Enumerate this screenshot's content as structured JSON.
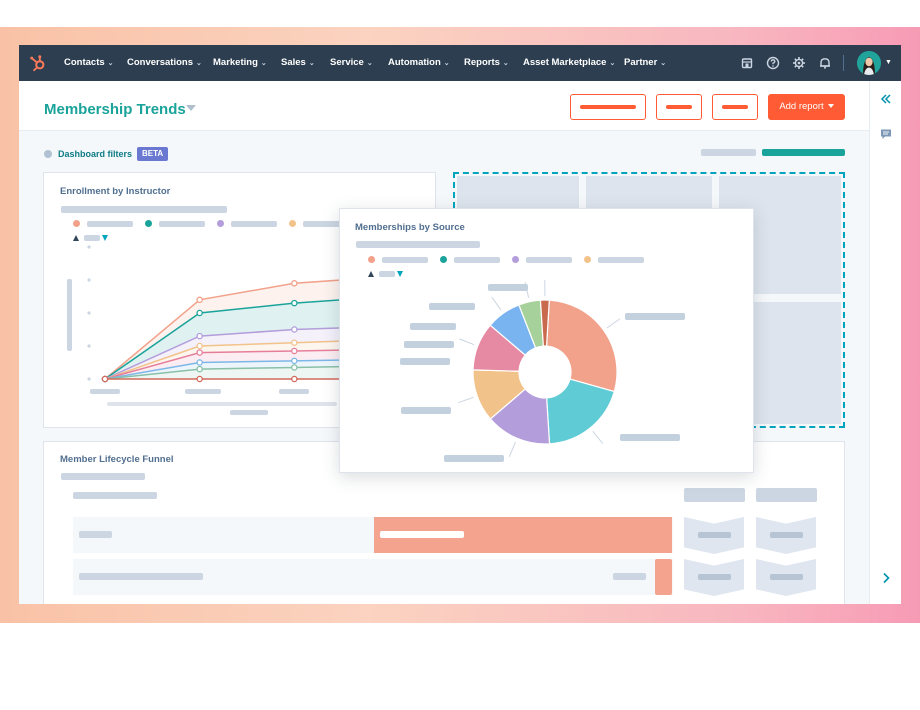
{
  "nav": {
    "items": [
      {
        "label": "Contacts",
        "has_caret": true
      },
      {
        "label": "Conversations",
        "has_caret": true
      },
      {
        "label": "Marketing",
        "has_caret": true
      },
      {
        "label": "Sales",
        "has_caret": true
      },
      {
        "label": "Service",
        "has_caret": true
      },
      {
        "label": "Automation",
        "has_caret": true
      },
      {
        "label": "Reports",
        "has_caret": true
      },
      {
        "label": "Asset Marketplace",
        "has_caret": true
      },
      {
        "label": "Partner",
        "has_caret": true
      }
    ],
    "caret_glyph": "⌄",
    "icons": [
      "marketplace-icon",
      "help-icon",
      "settings-icon",
      "notifications-icon"
    ]
  },
  "header": {
    "title": "Membership Trends",
    "add_report_label": "Add report"
  },
  "filters": {
    "label": "Dashboard filters",
    "badge": "BETA"
  },
  "cards": {
    "enrollment": {
      "title": "Enrollment by Instructor"
    },
    "sources": {
      "title": "Memberships by Source"
    },
    "funnel": {
      "title": "Member Lifecycle Funnel"
    }
  },
  "colors": {
    "accent": "#ff5c35",
    "teal": "#1aa39a",
    "nav_bg": "#2d3e50",
    "series": [
      "#f2a18a",
      "#1aa39a",
      "#b39ddb",
      "#f2c28b",
      "#e67e9b",
      "#88c0a8",
      "#d2685a"
    ]
  },
  "chart_data": [
    {
      "type": "line",
      "title": "Enrollment by Instructor",
      "x": [
        1,
        2,
        3,
        4
      ],
      "series": [
        {
          "color": "#f2a18a",
          "values": [
            0,
            24,
            29,
            31
          ]
        },
        {
          "color": "#1aa39a",
          "values": [
            0,
            20,
            23,
            25
          ]
        },
        {
          "color": "#b39ddb",
          "values": [
            0,
            13,
            15,
            16
          ]
        },
        {
          "color": "#f2c28b",
          "values": [
            0,
            10,
            11,
            12
          ]
        },
        {
          "color": "#e67e9b",
          "values": [
            0,
            8,
            8.5,
            9
          ]
        },
        {
          "color": "#7cb7e8",
          "values": [
            0,
            5,
            5.5,
            6
          ]
        },
        {
          "color": "#88c0a8",
          "values": [
            0,
            3,
            3.5,
            4
          ]
        },
        {
          "color": "#d2685a",
          "values": [
            0,
            0,
            0,
            0
          ]
        }
      ],
      "ylim": [
        0,
        40
      ]
    },
    {
      "type": "pie",
      "title": "Memberships by Source",
      "donut": true,
      "slices": [
        {
          "value": 29,
          "color": "#f2a18a"
        },
        {
          "value": 20,
          "color": "#5fcbd4"
        },
        {
          "value": 15,
          "color": "#b39ddb"
        },
        {
          "value": 12,
          "color": "#f2c28b"
        },
        {
          "value": 11,
          "color": "#e689a3"
        },
        {
          "value": 8,
          "color": "#7ab4f0"
        },
        {
          "value": 5,
          "color": "#a7d19b"
        },
        {
          "value": 2,
          "color": "#c96a4f"
        }
      ]
    },
    {
      "type": "bar",
      "title": "Member Lifecycle Funnel",
      "orientation": "horizontal",
      "categories": [
        "",
        ""
      ],
      "values": [
        100,
        6
      ],
      "color": "#f4a48e"
    }
  ]
}
